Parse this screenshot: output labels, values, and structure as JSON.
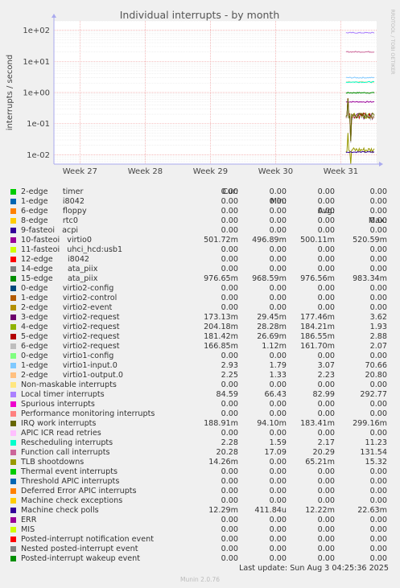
{
  "chart_data": {
    "type": "line",
    "title": "Individual interrupts - by month",
    "ylabel": "interrupts / second",
    "yscale": "log",
    "ylim": [
      0.005,
      200
    ],
    "yticks": [
      {
        "v": 100,
        "t": "1e+02"
      },
      {
        "v": 10,
        "t": "1e+01"
      },
      {
        "v": 1,
        "t": "1e+00"
      },
      {
        "v": 0.1,
        "t": "1e-01"
      },
      {
        "v": 0.01,
        "t": "1e-02"
      }
    ],
    "xticks": [
      {
        "v": 27,
        "t": "Week 27"
      },
      {
        "v": 28,
        "t": "Week 28"
      },
      {
        "v": 29,
        "t": "Week 29"
      },
      {
        "v": 30,
        "t": "Week 30"
      },
      {
        "v": 31,
        "t": "Week 31"
      }
    ],
    "xlim": [
      26.6,
      31.55
    ],
    "data_start_week": 31.08,
    "grid": true,
    "side_label": "RRDTOOL / TOBI OETIKER",
    "columns": [
      "Cur:",
      "Min:",
      "Avg:",
      "Max:"
    ],
    "series": [
      {
        "label": "2-edge      timer",
        "color": "#00cc00",
        "cur": "0.00",
        "min": "0.00",
        "avg": "0.00",
        "max": "0.00"
      },
      {
        "label": "1-edge      i8042",
        "color": "#0066b3",
        "cur": "0.00",
        "min": "0.00",
        "avg": "0.00",
        "max": "0.00"
      },
      {
        "label": "6-edge      floppy",
        "color": "#ff8000",
        "cur": "0.00",
        "min": "0.00",
        "avg": "0.00",
        "max": "0.00"
      },
      {
        "label": "8-edge      rtc0",
        "color": "#ffcc00",
        "cur": "0.00",
        "min": "0.00",
        "avg": "0.00",
        "max": "0.00"
      },
      {
        "label": "9-fasteoi   acpi",
        "color": "#330099",
        "cur": "0.00",
        "min": "0.00",
        "avg": "0.00",
        "max": "0.00"
      },
      {
        "label": "10-fasteoi   virtio0",
        "color": "#990099",
        "cur": "501.72m",
        "min": "496.89m",
        "avg": "500.11m",
        "max": "520.59m",
        "level": 0.5
      },
      {
        "label": "11-fasteoi   uhci_hcd:usb1",
        "color": "#ccff00",
        "cur": "0.00",
        "min": "0.00",
        "avg": "0.00",
        "max": "0.00"
      },
      {
        "label": "12-edge      i8042",
        "color": "#ff0000",
        "cur": "0.00",
        "min": "0.00",
        "avg": "0.00",
        "max": "0.00"
      },
      {
        "label": "14-edge      ata_piix",
        "color": "#808080",
        "cur": "0.00",
        "min": "0.00",
        "avg": "0.00",
        "max": "0.00"
      },
      {
        "label": "15-edge      ata_piix",
        "color": "#008f00",
        "cur": "976.65m",
        "min": "968.59m",
        "avg": "976.56m",
        "max": "983.34m",
        "level": 0.98
      },
      {
        "label": "0-edge      virtio2-config",
        "color": "#00487d",
        "cur": "0.00",
        "min": "0.00",
        "avg": "0.00",
        "max": "0.00"
      },
      {
        "label": "1-edge      virtio2-control",
        "color": "#b35a00",
        "cur": "0.00",
        "min": "0.00",
        "avg": "0.00",
        "max": "0.00"
      },
      {
        "label": "2-edge      virtio2-event",
        "color": "#b38f00",
        "cur": "0.00",
        "min": "0.00",
        "avg": "0.00",
        "max": "0.00"
      },
      {
        "label": "3-edge      virtio2-request",
        "color": "#6b006b",
        "cur": "173.13m",
        "min": "29.45m",
        "avg": "177.46m",
        "max": "3.62",
        "level": 0.177,
        "noisy": true
      },
      {
        "label": "4-edge      virtio2-request",
        "color": "#8fb300",
        "cur": "204.18m",
        "min": "28.28m",
        "avg": "184.21m",
        "max": "1.93",
        "level": 0.184,
        "noisy": true
      },
      {
        "label": "5-edge      virtio2-request",
        "color": "#b30000",
        "cur": "181.42m",
        "min": "26.69m",
        "avg": "186.55m",
        "max": "2.88",
        "level": 0.186,
        "noisy": true
      },
      {
        "label": "6-edge      virtio2-request",
        "color": "#bebebe",
        "cur": "166.85m",
        "min": "1.12m",
        "avg": "161.70m",
        "max": "2.07",
        "level": 0.16,
        "noisy": true
      },
      {
        "label": "0-edge      virtio1-config",
        "color": "#80ff80",
        "cur": "0.00",
        "min": "0.00",
        "avg": "0.00",
        "max": "0.00"
      },
      {
        "label": "1-edge      virtio1-input.0",
        "color": "#80c9ff",
        "cur": "2.93",
        "min": "1.79",
        "avg": "3.07",
        "max": "70.66",
        "level": 3.0
      },
      {
        "label": "2-edge      virtio1-output.0",
        "color": "#ffc080",
        "cur": "2.25",
        "min": "1.33",
        "avg": "2.23",
        "max": "20.80",
        "level": 2.2
      },
      {
        "label": "Non-maskable interrupts",
        "color": "#ffe680",
        "cur": "0.00",
        "min": "0.00",
        "avg": "0.00",
        "max": "0.00"
      },
      {
        "label": "Local timer interrupts",
        "color": "#aa80ff",
        "cur": "84.59",
        "min": "66.43",
        "avg": "82.99",
        "max": "292.77",
        "level": 83
      },
      {
        "label": "Spurious interrupts",
        "color": "#ee00cc",
        "cur": "0.00",
        "min": "0.00",
        "avg": "0.00",
        "max": "0.00"
      },
      {
        "label": "Performance monitoring interrupts",
        "color": "#ff8080",
        "cur": "0.00",
        "min": "0.00",
        "avg": "0.00",
        "max": "0.00"
      },
      {
        "label": "IRQ work interrupts",
        "color": "#666600",
        "cur": "188.91m",
        "min": "94.10m",
        "avg": "183.41m",
        "max": "299.16m",
        "level": 0.183,
        "noisy": true
      },
      {
        "label": "APIC ICR read retries",
        "color": "#ffbfff",
        "cur": "0.00",
        "min": "0.00",
        "avg": "0.00",
        "max": "0.00"
      },
      {
        "label": "Rescheduling interrupts",
        "color": "#00ffcc",
        "cur": "2.28",
        "min": "1.59",
        "avg": "2.17",
        "max": "11.23",
        "level": 2.17
      },
      {
        "label": "Function call interrupts",
        "color": "#cc6699",
        "cur": "20.28",
        "min": "17.09",
        "avg": "20.29",
        "max": "131.54",
        "level": 20.3
      },
      {
        "label": "TLB shootdowns",
        "color": "#999900",
        "cur": "14.26m",
        "min": "0.00",
        "avg": "65.21m",
        "max": "15.32",
        "level": 0.0143,
        "noisy": true
      },
      {
        "label": "Thermal event interrupts",
        "color": "#00cc00",
        "cur": "0.00",
        "min": "0.00",
        "avg": "0.00",
        "max": "0.00"
      },
      {
        "label": "Threshold APIC interrupts",
        "color": "#0066b3",
        "cur": "0.00",
        "min": "0.00",
        "avg": "0.00",
        "max": "0.00"
      },
      {
        "label": "Deferred Error APIC interrupts",
        "color": "#ff8000",
        "cur": "0.00",
        "min": "0.00",
        "avg": "0.00",
        "max": "0.00"
      },
      {
        "label": "Machine check exceptions",
        "color": "#ffcc00",
        "cur": "0.00",
        "min": "0.00",
        "avg": "0.00",
        "max": "0.00"
      },
      {
        "label": "Machine check polls",
        "color": "#330099",
        "cur": "12.29m",
        "min": "411.84u",
        "avg": "12.22m",
        "max": "22.63m",
        "level": 0.0122
      },
      {
        "label": "ERR",
        "color": "#990099",
        "cur": "0.00",
        "min": "0.00",
        "avg": "0.00",
        "max": "0.00"
      },
      {
        "label": "MIS",
        "color": "#ccff00",
        "cur": "0.00",
        "min": "0.00",
        "avg": "0.00",
        "max": "0.00"
      },
      {
        "label": "Posted-interrupt notification event",
        "color": "#ff0000",
        "cur": "0.00",
        "min": "0.00",
        "avg": "0.00",
        "max": "0.00"
      },
      {
        "label": "Nested posted-interrupt event",
        "color": "#808080",
        "cur": "0.00",
        "min": "0.00",
        "avg": "0.00",
        "max": "0.00"
      },
      {
        "label": "Posted-interrupt wakeup event",
        "color": "#008f00",
        "cur": "0.00",
        "min": "0.00",
        "avg": "0.00",
        "max": "0.00"
      }
    ]
  },
  "footer": {
    "last_update": "Last update: Sun Aug  3 04:25:36 2025",
    "version": "Munin 2.0.76"
  }
}
